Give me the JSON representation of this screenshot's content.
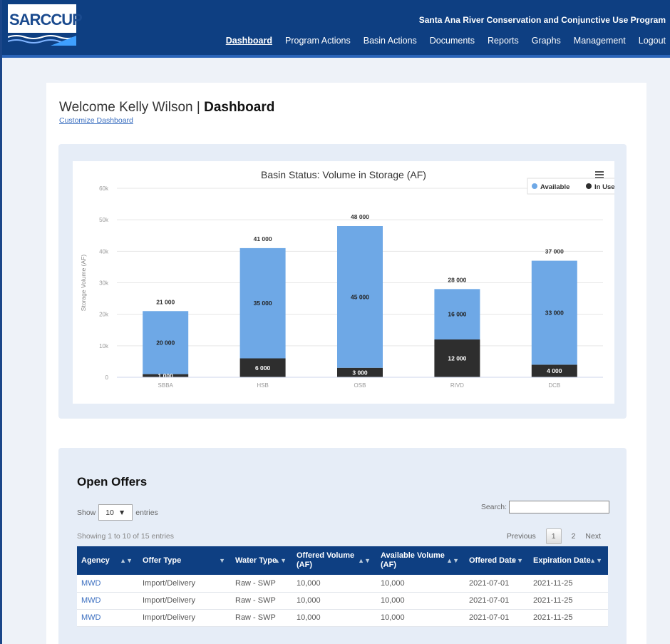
{
  "header": {
    "logo_text": "SARCCUP",
    "program_title": "Santa Ana River Conservation and Conjunctive Use Program",
    "nav": [
      {
        "label": "Dashboard",
        "active": true
      },
      {
        "label": "Program Actions",
        "active": false
      },
      {
        "label": "Basin Actions",
        "active": false
      },
      {
        "label": "Documents",
        "active": false
      },
      {
        "label": "Reports",
        "active": false
      },
      {
        "label": "Graphs",
        "active": false
      },
      {
        "label": "Management",
        "active": false
      },
      {
        "label": "Logout",
        "active": false
      }
    ]
  },
  "welcome": {
    "prefix": "Welcome Kelly Wilson | ",
    "page": "Dashboard",
    "customize_link": "Customize Dashboard"
  },
  "chart_data": {
    "type": "bar",
    "stacked": true,
    "title": "Basin Status: Volume in Storage (AF)",
    "ylabel": "Storage Volume (AF)",
    "xlabel": "",
    "categories": [
      "SBBA",
      "HSB",
      "OSB",
      "RIVD",
      "DCB"
    ],
    "ylim": [
      0,
      60000
    ],
    "yticks": [
      "0",
      "10k",
      "20k",
      "30k",
      "40k",
      "50k",
      "60k"
    ],
    "legend": "top-right",
    "series": [
      {
        "name": "Available",
        "color": "#6ea8e6",
        "values": [
          20000,
          35000,
          45000,
          16000,
          33000
        ],
        "labels": [
          "20 000",
          "35 000",
          "45 000",
          "16 000",
          "33 000"
        ]
      },
      {
        "name": "In Use",
        "color": "#2e2e2e",
        "values": [
          1000,
          6000,
          3000,
          12000,
          4000
        ],
        "labels": [
          "1 000",
          "6 000",
          "3 000",
          "12 000",
          "4 000"
        ]
      }
    ],
    "totals": [
      "21 000",
      "41 000",
      "48 000",
      "28 000",
      "37 000"
    ],
    "menu_icon": "hamburger-icon"
  },
  "offers": {
    "title": "Open Offers",
    "show_label": "Show",
    "entries_label": "entries",
    "page_size": "10",
    "search_label": "Search:",
    "search_value": "",
    "showing_text": "Showing 1 to 10 of 15 entries",
    "pager": {
      "previous": "Previous",
      "current": "1",
      "next_page": "2",
      "next": "Next"
    },
    "columns": [
      "Agency",
      "Offer Type",
      "Water Type",
      "Offered Volume (AF)",
      "Available Volume (AF)",
      "Offered Date",
      "Expiration Date"
    ],
    "rows": [
      [
        "MWD",
        "Import/Delivery",
        "Raw - SWP",
        "10,000",
        "10,000",
        "2021-07-01",
        "2021-11-25"
      ],
      [
        "MWD",
        "Import/Delivery",
        "Raw - SWP",
        "10,000",
        "10,000",
        "2021-07-01",
        "2021-11-25"
      ],
      [
        "MWD",
        "Import/Delivery",
        "Raw - SWP",
        "10,000",
        "10,000",
        "2021-07-01",
        "2021-11-25"
      ]
    ]
  }
}
